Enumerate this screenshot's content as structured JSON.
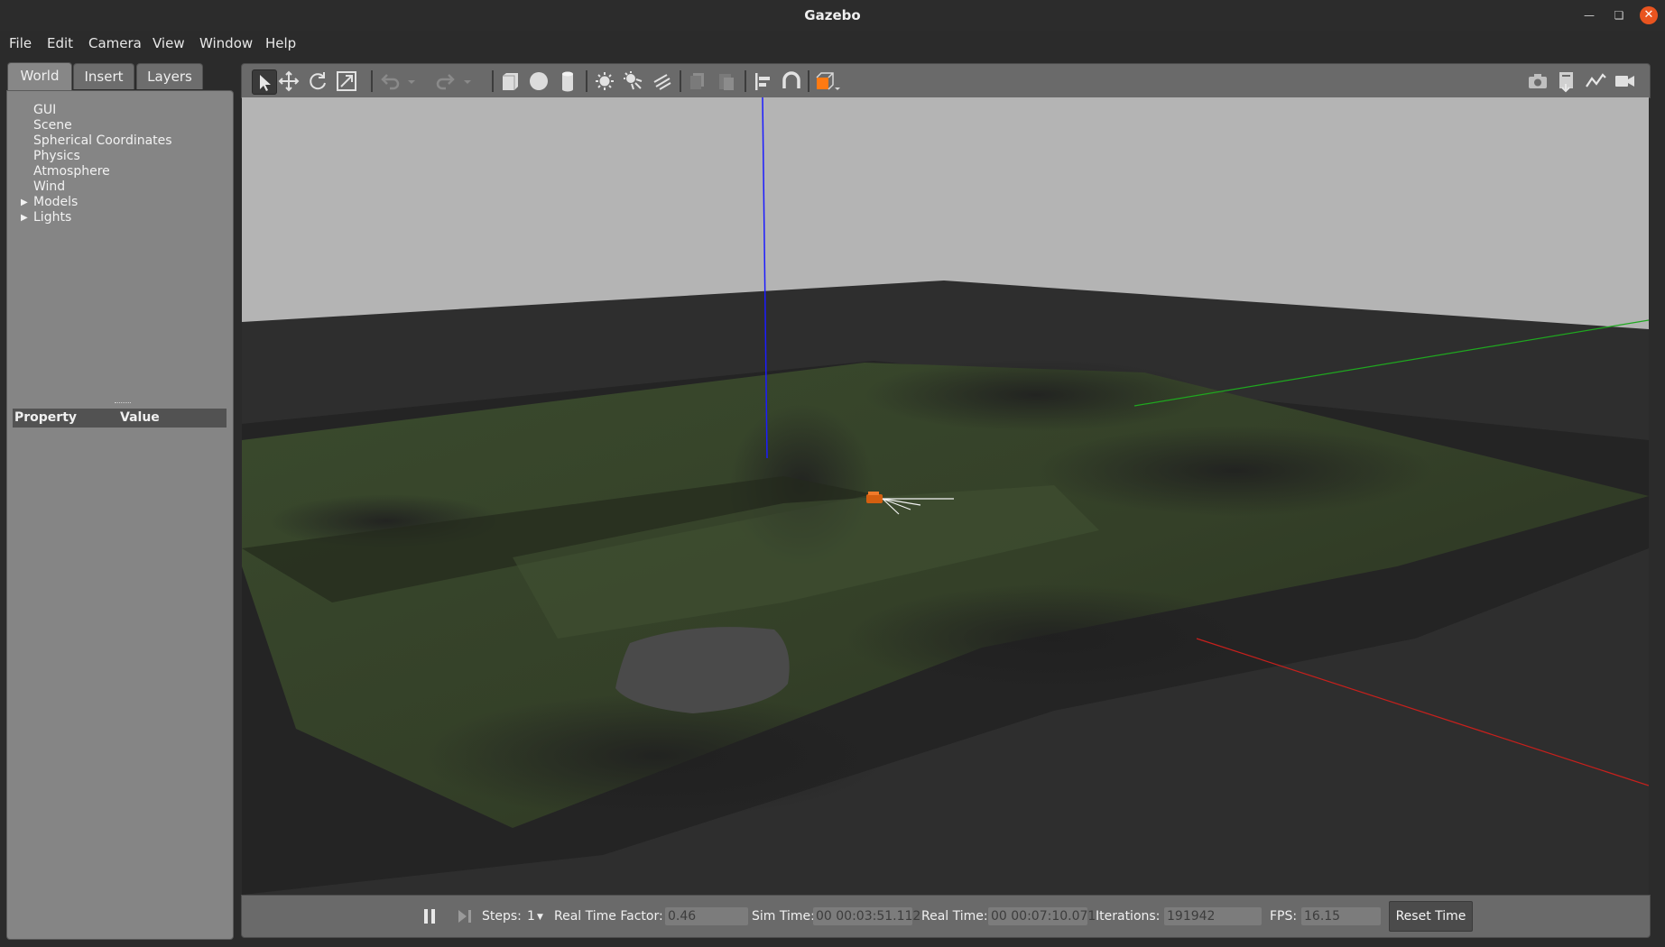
{
  "window": {
    "title": "Gazebo"
  },
  "menu": {
    "items": [
      "File",
      "Edit",
      "Camera",
      "View",
      "Window",
      "Help"
    ]
  },
  "left_panel": {
    "tabs": [
      {
        "label": "World",
        "active": true
      },
      {
        "label": "Insert",
        "active": false
      },
      {
        "label": "Layers",
        "active": false
      }
    ],
    "tree": [
      {
        "label": "GUI",
        "expandable": false
      },
      {
        "label": "Scene",
        "expandable": false
      },
      {
        "label": "Spherical Coordinates",
        "expandable": false
      },
      {
        "label": "Physics",
        "expandable": false
      },
      {
        "label": "Atmosphere",
        "expandable": false
      },
      {
        "label": "Wind",
        "expandable": false
      },
      {
        "label": "Models",
        "expandable": true
      },
      {
        "label": "Lights",
        "expandable": true
      }
    ],
    "property_table": {
      "col_property": "Property",
      "col_value": "Value"
    }
  },
  "toolbar": {
    "left_tools": [
      "select-mode-icon",
      "translate-mode-icon",
      "rotate-mode-icon",
      "scale-mode-icon",
      "undo-icon",
      "undo-history-icon",
      "redo-icon",
      "redo-history-icon",
      "box-shape-icon",
      "sphere-shape-icon",
      "cylinder-shape-icon",
      "point-light-icon",
      "spot-light-icon",
      "directional-light-icon",
      "copy-icon",
      "paste-icon",
      "align-icon",
      "snap-icon",
      "view-angle-icon"
    ],
    "right_tools": [
      "screenshot-icon",
      "log-data-icon",
      "plot-icon",
      "video-record-icon"
    ],
    "active_tool": "select-mode-icon",
    "accent_color": "#ff7a12"
  },
  "bottom_bar": {
    "paused": false,
    "steps_label": "Steps:",
    "steps_value": "1",
    "real_time_factor_label": "Real Time Factor:",
    "real_time_factor": "0.46",
    "sim_time_label": "Sim Time:",
    "sim_time": "00 00:03:51.112",
    "real_time_label": "Real Time:",
    "real_time": "00 00:07:10.071",
    "iterations_label": "Iterations:",
    "iterations": "191942",
    "fps_label": "FPS:",
    "fps": "16.15",
    "reset_time_label": "Reset Time"
  },
  "colors": {
    "sky": "#b4b4b4",
    "ground": "#2b2b2b",
    "terrain_green": "#3c4a2e",
    "z_axis": "#1c1cff",
    "y_axis": "#1fa81f",
    "x_axis": "#c8201c",
    "robot": "#d45f10"
  }
}
